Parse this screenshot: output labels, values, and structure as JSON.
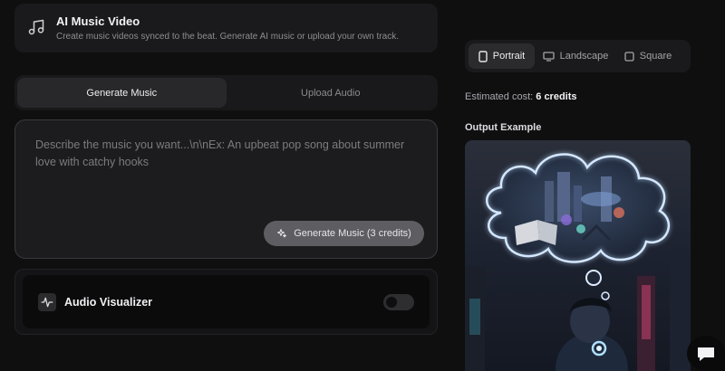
{
  "header": {
    "title": "AI Music Video",
    "subtitle": "Create music videos synced to the beat. Generate AI music or upload your own track.",
    "icon": "music-note-icon"
  },
  "tabs": [
    {
      "label": "Generate Music",
      "active": true
    },
    {
      "label": "Upload Audio",
      "active": false
    }
  ],
  "prompt": {
    "placeholder": "Describe the music you want...\\n\\nEx: An upbeat pop song about summer love with catchy hooks",
    "generate_label": "Generate Music (3 credits)"
  },
  "visualizer": {
    "label": "Audio Visualizer",
    "enabled": false
  },
  "aspect": {
    "options": [
      {
        "label": "Portrait",
        "icon": "portrait-icon",
        "active": true
      },
      {
        "label": "Landscape",
        "icon": "landscape-icon",
        "active": false
      },
      {
        "label": "Square",
        "icon": "square-icon",
        "active": false
      }
    ]
  },
  "cost": {
    "prefix": "Estimated cost:",
    "value": "6 credits"
  },
  "output": {
    "label": "Output Example"
  },
  "colors": {
    "background": "#0f0f10",
    "card": "#1a1a1c",
    "accent_glow": "#cfe6ff"
  }
}
